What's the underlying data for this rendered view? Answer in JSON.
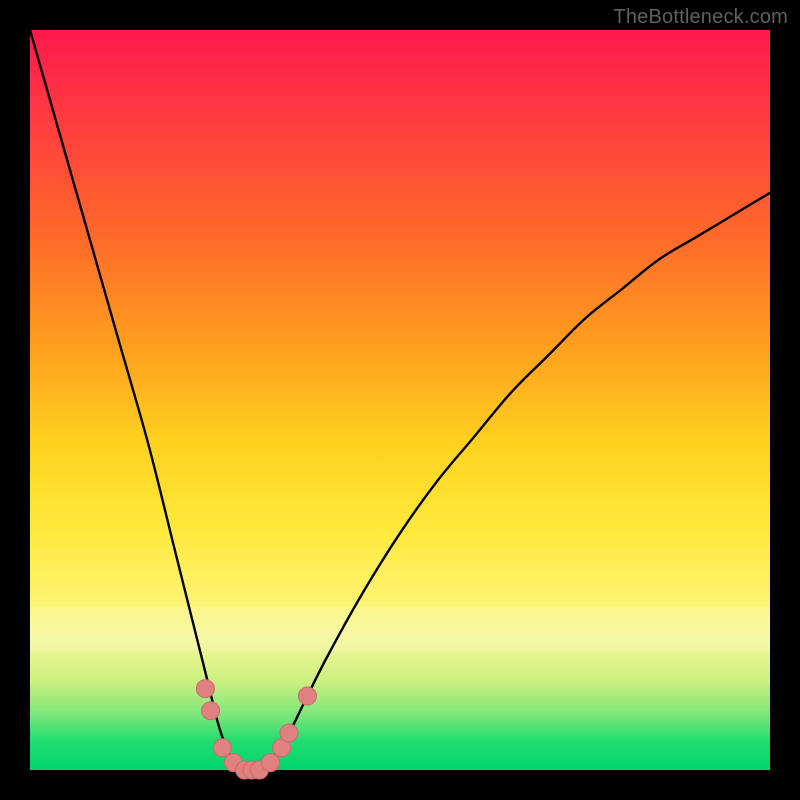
{
  "watermark": "TheBottleneck.com",
  "colors": {
    "curve": "#000000",
    "marker_fill": "#e08080",
    "marker_stroke": "#c86b6b",
    "background_black": "#000000"
  },
  "chart_data": {
    "type": "line",
    "title": "",
    "xlabel": "",
    "ylabel": "",
    "xlim": [
      0,
      100
    ],
    "ylim": [
      0,
      100
    ],
    "grid": false,
    "legend": false,
    "series": [
      {
        "name": "bottleneck-curve",
        "x": [
          0,
          4,
          8,
          12,
          16,
          19.5,
          22,
          24,
          25.5,
          27,
          28.3,
          29.5,
          30.5,
          31.5,
          33,
          35,
          37,
          40,
          45,
          50,
          55,
          60,
          65,
          70,
          75,
          80,
          85,
          90,
          95,
          100
        ],
        "values": [
          100,
          86,
          72,
          58,
          44,
          30,
          20,
          12,
          6,
          2,
          0.5,
          0,
          0,
          0.5,
          2,
          5,
          9,
          15,
          24,
          32,
          39,
          45,
          51,
          56,
          61,
          65,
          69,
          72,
          75,
          78
        ]
      }
    ],
    "markers": [
      {
        "x": 23.7,
        "y": 11
      },
      {
        "x": 24.4,
        "y": 8
      },
      {
        "x": 26.0,
        "y": 3
      },
      {
        "x": 27.5,
        "y": 1
      },
      {
        "x": 29.0,
        "y": 0
      },
      {
        "x": 30.0,
        "y": 0
      },
      {
        "x": 31.0,
        "y": 0
      },
      {
        "x": 32.5,
        "y": 1
      },
      {
        "x": 34.0,
        "y": 3
      },
      {
        "x": 35.0,
        "y": 5
      },
      {
        "x": 37.5,
        "y": 10
      }
    ],
    "marker_radius": 9
  }
}
